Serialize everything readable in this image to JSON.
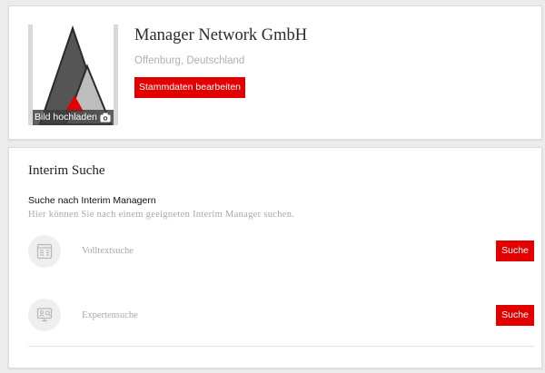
{
  "profile": {
    "company_name": "Manager Network GmbH",
    "location": "Offenburg, Deutschland",
    "edit_button": "Stammdaten bearbeiten",
    "upload_label": "Bild hochladen",
    "upload_icon": "camera-icon",
    "logo_colors": {
      "dark": "#555555",
      "light": "#bdbdbd",
      "accent": "#e20000"
    }
  },
  "interim_search": {
    "title": "Interim Suche",
    "subtitle": "Suche nach Interim Managern",
    "description": "Hier können Sie nach einem geeigneten Interim Manager suchen.",
    "options": [
      {
        "label": "Volltextsuche",
        "icon": "fulltext-search-icon",
        "button": "Suche"
      },
      {
        "label": "Expertensuche",
        "icon": "expert-search-icon",
        "button": "Suche"
      }
    ]
  },
  "colors": {
    "accent": "#e20000",
    "background": "#ececec",
    "card": "#ffffff",
    "muted_text": "#a8a8a8"
  }
}
